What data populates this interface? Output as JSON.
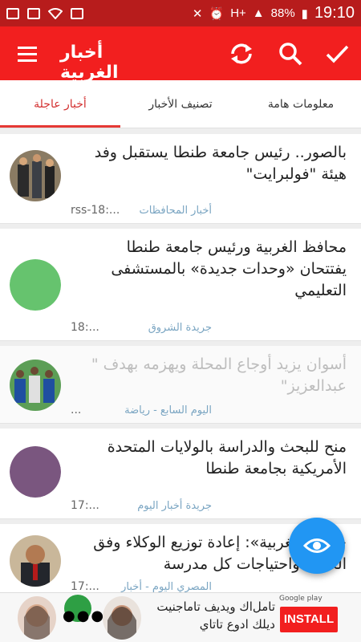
{
  "status_bar": {
    "battery": "88%",
    "time": "19:10",
    "network": "H+"
  },
  "toolbar": {
    "title": "أخبار الغربية"
  },
  "tabs": [
    {
      "label": "معلومات هامة"
    },
    {
      "label": "تصنيف الأخبار"
    },
    {
      "label": "أخبار عاجلة"
    }
  ],
  "news": [
    {
      "headline": "بالصور.. رئيس جامعة طنطا يستقبل وفد هيئة \"فولبرايت\"",
      "source": "أخبار المحافظات",
      "time": "rss-18:..."
    },
    {
      "headline": "محافظ الغربية ورئيس جامعة طنطا يفتتحان «وحدات جديدة» بالمستشفى التعليمي",
      "source": "جريدة الشروق",
      "time": "18:..."
    },
    {
      "headline": "أسوان يزيد أوجاع المحلة ويهزمه بهدف \" عبدالعزيز\"",
      "source": "اليوم السابع - رياضة",
      "time": "..."
    },
    {
      "headline": "منح للبحث والدراسة بالولايات المتحدة الأمريكية بجامعة طنطا",
      "source": "جريدة أخبار اليوم",
      "time": "17:..."
    },
    {
      "headline": "«تعليم الغربية»: إعادة توزيع الوكلاء وفق الكثافة واحتياجات كل مدرسة",
      "source": "المصري اليوم - أخبار",
      "time": "17:..."
    }
  ],
  "ad": {
    "text": "تامل‌اك ويديف تاماجنيت ديلك ادوع تاتاي",
    "install_label": "INSTALL",
    "badge": "Google play"
  }
}
